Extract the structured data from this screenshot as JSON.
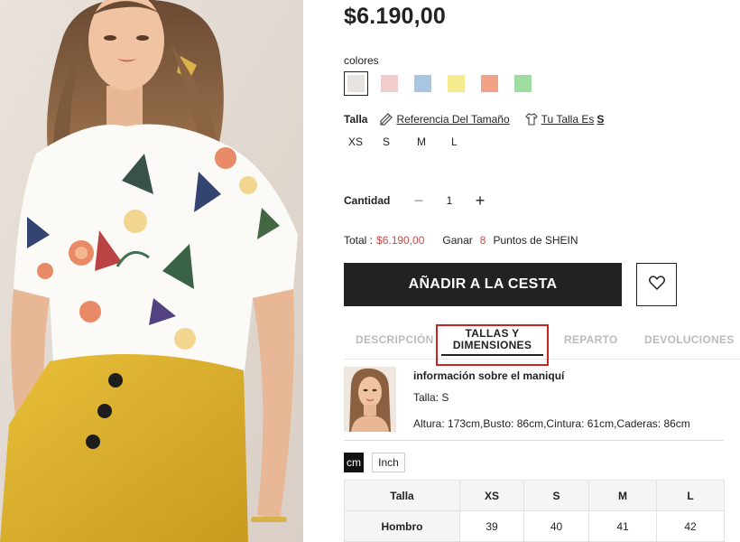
{
  "product": {
    "price": "$6.190,00"
  },
  "colors": {
    "label": "colores",
    "swatches": [
      {
        "name": "blanco",
        "hex": "#e6e3e0",
        "selected": true
      },
      {
        "name": "rosa",
        "hex": "#f0cdcb"
      },
      {
        "name": "azul",
        "hex": "#a9c6e1"
      },
      {
        "name": "amarillo",
        "hex": "#f4ea8e"
      },
      {
        "name": "coral",
        "hex": "#f1a287"
      },
      {
        "name": "verde",
        "hex": "#9fdc9f"
      }
    ]
  },
  "size": {
    "label": "Talla",
    "reference_link": "Referencia Del Tamaño",
    "your_size_prefix": "Tu Talla Es",
    "your_size_value": "S",
    "options": [
      "XS",
      "S",
      "M",
      "L"
    ]
  },
  "quantity": {
    "label": "Cantidad",
    "minus": "−",
    "value": "1",
    "plus": "+"
  },
  "total": {
    "label": "Total :",
    "amount": "$6.190,00",
    "earn_prefix": "Ganar",
    "points": "8",
    "earn_suffix": "Puntos de SHEIN"
  },
  "actions": {
    "add_to_cart": "AÑADIR A LA CESTA"
  },
  "tabs": [
    {
      "label": "DESCRIPCIÓN"
    },
    {
      "label_line1": "TALLAS Y",
      "label_line2": "DIMENSIONES",
      "active": true
    },
    {
      "label": "REPARTO"
    },
    {
      "label": "DEVOLUCIONES"
    }
  ],
  "model_info": {
    "title": "información sobre el maniquí",
    "size": "Talla: S",
    "measurements": "Altura: 173cm,Busto: 86cm,Cintura: 61cm,Caderas: 86cm"
  },
  "units": {
    "cm": "cm",
    "inch": "Inch"
  },
  "size_table": {
    "headers": [
      "Talla",
      "XS",
      "S",
      "M",
      "L"
    ],
    "rows": [
      {
        "label": "Hombro",
        "values": [
          "39",
          "40",
          "41",
          "42"
        ]
      }
    ]
  },
  "icons": [
    "hanger-icon",
    "tshirt-icon",
    "heart-icon"
  ],
  "accent_colors": {
    "price_red": "#c44a4a",
    "highlight_red": "#cc2222",
    "button_black": "#222222"
  }
}
